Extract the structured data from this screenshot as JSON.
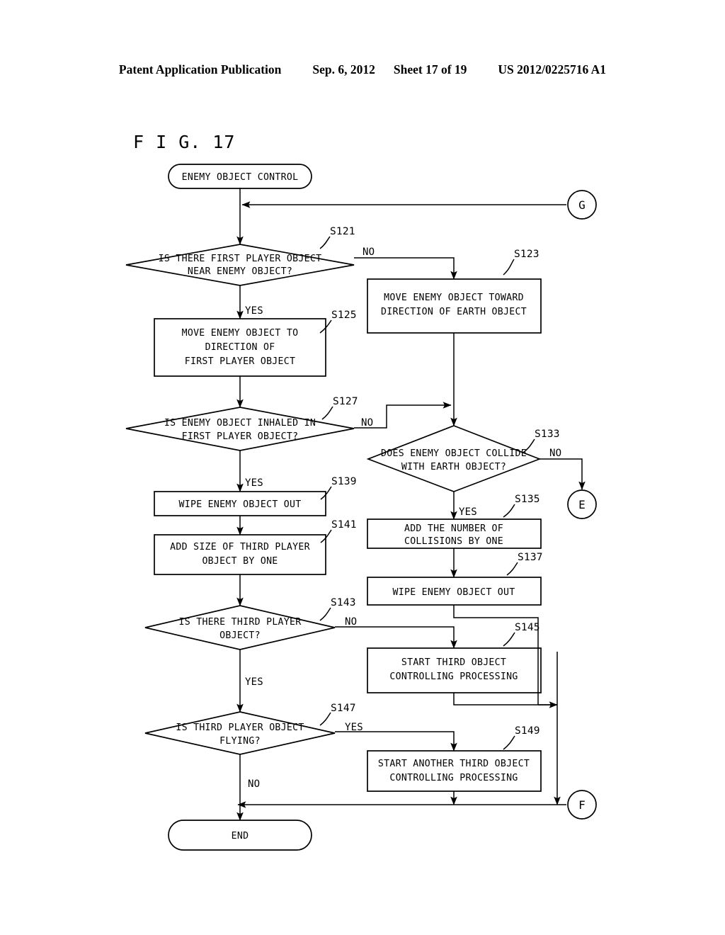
{
  "header": {
    "publication": "Patent Application Publication",
    "date": "Sep. 6, 2012",
    "sheet": "Sheet 17 of 19",
    "patent_number": "US 2012/0225716 A1"
  },
  "figure": {
    "label": "F I G. 17"
  },
  "nodes": {
    "start": {
      "text": "ENEMY OBJECT CONTROL",
      "shape": "terminal"
    },
    "end": {
      "text": "END",
      "shape": "terminal"
    },
    "s121": {
      "line1": "IS THERE FIRST PLAYER OBJECT",
      "line2": "NEAR ENEMY OBJECT?",
      "shape": "decision"
    },
    "s123": {
      "line1": "MOVE ENEMY OBJECT TOWARD",
      "line2": "DIRECTION OF EARTH OBJECT",
      "shape": "process"
    },
    "s125": {
      "line1": "MOVE ENEMY OBJECT TO",
      "line2": "DIRECTION OF",
      "line3": "FIRST PLAYER OBJECT",
      "shape": "process"
    },
    "s127": {
      "line1": "IS ENEMY OBJECT INHALED IN",
      "line2": "FIRST PLAYER OBJECT?",
      "shape": "decision"
    },
    "s133": {
      "line1": "DOES ENEMY OBJECT COLLIDE",
      "line2": "WITH EARTH OBJECT?",
      "shape": "decision"
    },
    "s135": {
      "line1": "ADD THE NUMBER OF",
      "line2": "COLLISIONS BY ONE",
      "shape": "process"
    },
    "s137": {
      "line1": "WIPE ENEMY OBJECT OUT",
      "shape": "process"
    },
    "s139": {
      "line1": "WIPE ENEMY OBJECT OUT",
      "shape": "process"
    },
    "s141": {
      "line1": "ADD SIZE OF THIRD PLAYER",
      "line2": "OBJECT BY ONE",
      "shape": "process"
    },
    "s143": {
      "line1": "IS THERE THIRD PLAYER",
      "line2": "OBJECT?",
      "shape": "decision"
    },
    "s145": {
      "line1": "START THIRD OBJECT",
      "line2": "CONTROLLING PROCESSING",
      "shape": "process"
    },
    "s147": {
      "line1": "IS THIRD PLAYER OBJECT",
      "line2": "FLYING?",
      "shape": "decision"
    },
    "s149": {
      "line1": "START ANOTHER THIRD OBJECT",
      "line2": "CONTROLLING PROCESSING",
      "shape": "process"
    }
  },
  "step_labels": {
    "s121": "S121",
    "s123": "S123",
    "s125": "S125",
    "s127": "S127",
    "s133": "S133",
    "s135": "S135",
    "s137": "S137",
    "s139": "S139",
    "s141": "S141",
    "s143": "S143",
    "s145": "S145",
    "s147": "S147",
    "s149": "S149"
  },
  "connectors": {
    "g": "G",
    "e": "E",
    "f": "F"
  },
  "branch_labels": {
    "s121_no": "NO",
    "s121_yes": "YES",
    "s127_no": "NO",
    "s127_yes": "YES",
    "s133_no": "NO",
    "s133_yes": "YES",
    "s143_no": "NO",
    "s143_yes": "YES",
    "s147_yes": "YES",
    "s147_no": "NO"
  },
  "colors": {
    "ink": "#000000",
    "paper": "#ffffff"
  }
}
